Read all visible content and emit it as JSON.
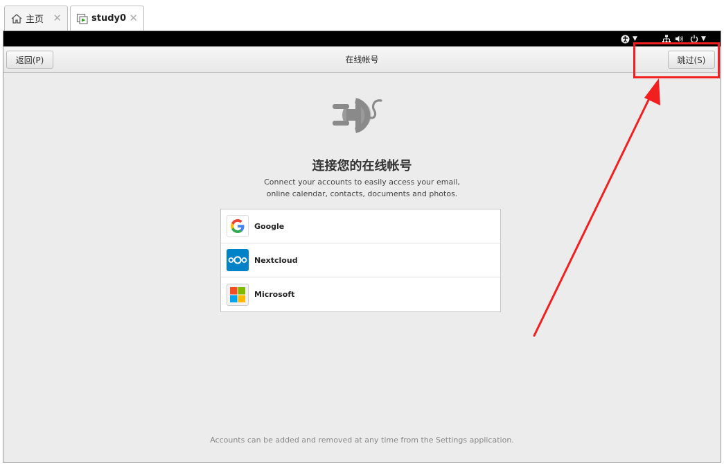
{
  "tabs": [
    {
      "label": "主页",
      "icon": "home-icon"
    },
    {
      "label": "study0",
      "icon": "vm-icon"
    }
  ],
  "tab_close_glyph": "✕",
  "topbar": {
    "accessibility_icon": "accessibility-icon",
    "network_icon": "network-icon",
    "volume_icon": "volume-icon",
    "power_icon": "power-icon"
  },
  "header": {
    "back_label": "返回(P)",
    "title": "在线帐号",
    "skip_label": "跳过(S)"
  },
  "main": {
    "heading": "连接您的在线帐号",
    "description_line1": "Connect your accounts to easily access your email,",
    "description_line2": "online calendar, contacts, documents and photos.",
    "providers": [
      {
        "name": "Google",
        "icon": "google-icon"
      },
      {
        "name": "Nextcloud",
        "icon": "nextcloud-icon"
      },
      {
        "name": "Microsoft",
        "icon": "microsoft-icon"
      }
    ],
    "footer": "Accounts can be added and removed at any time from the Settings application."
  },
  "colors": {
    "annotation": "#f21f1f",
    "nextcloud": "#0082c9",
    "google_blue": "#4285f4",
    "google_red": "#ea4335",
    "google_yellow": "#fbbc05",
    "google_green": "#34a853"
  }
}
